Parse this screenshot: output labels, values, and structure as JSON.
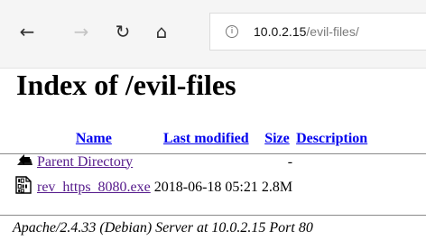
{
  "browser": {
    "back_icon": "←",
    "forward_icon": "→",
    "refresh_icon": "↻",
    "home_icon": "⌂",
    "info_icon": "i",
    "url_host": "10.0.2.15",
    "url_path": "/evil-files/"
  },
  "page": {
    "title": "Index of /evil-files",
    "columns": {
      "name": "Name",
      "last_modified": "Last modified",
      "size": "Size",
      "description": "Description"
    },
    "rows": [
      {
        "icon": "back-folder-icon",
        "name": "Parent Directory",
        "last_modified": "",
        "size": "-",
        "description": ""
      },
      {
        "icon": "binary-file-icon",
        "name": "rev_https_8080.exe",
        "last_modified": "2018-06-18 05:21",
        "size": "2.8M",
        "description": ""
      }
    ],
    "address": "Apache/2.4.33 (Debian) Server at 10.0.2.15 Port 80"
  }
}
